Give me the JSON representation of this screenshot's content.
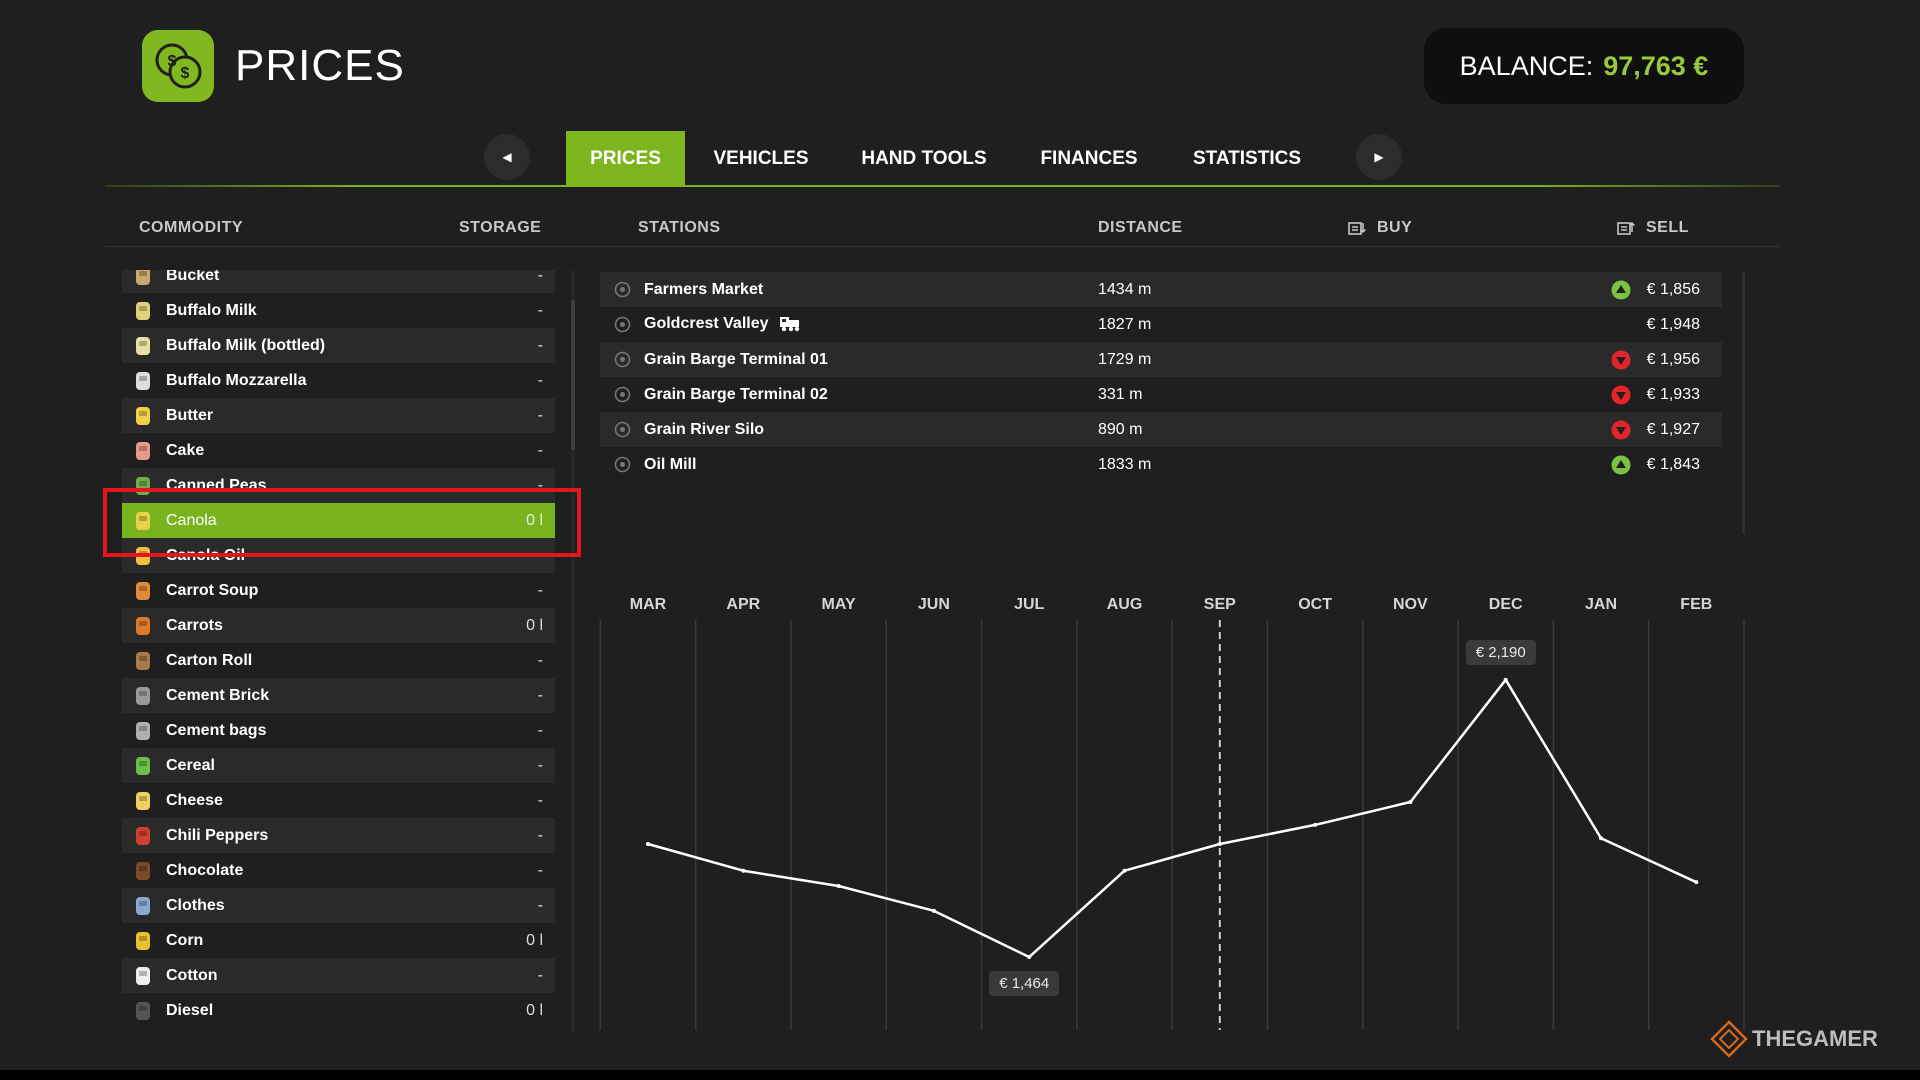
{
  "header": {
    "title": "PRICES",
    "balance_label": "BALANCE:",
    "balance_value": "97,763 €"
  },
  "tabs": [
    {
      "label": "PRICES",
      "active": true
    },
    {
      "label": "VEHICLES",
      "active": false
    },
    {
      "label": "HAND TOOLS",
      "active": false
    },
    {
      "label": "FINANCES",
      "active": false
    },
    {
      "label": "STATISTICS",
      "active": false
    }
  ],
  "columns": {
    "commodity": "COMMODITY",
    "storage": "STORAGE",
    "stations": "STATIONS",
    "distance": "DISTANCE",
    "buy": "BUY",
    "sell": "SELL"
  },
  "commodities": [
    {
      "name": "Bucket",
      "storage": "-"
    },
    {
      "name": "Buffalo Milk",
      "storage": "-"
    },
    {
      "name": "Buffalo Milk (bottled)",
      "storage": "-"
    },
    {
      "name": "Buffalo Mozzarella",
      "storage": "-"
    },
    {
      "name": "Butter",
      "storage": "-"
    },
    {
      "name": "Cake",
      "storage": "-"
    },
    {
      "name": "Canned Peas",
      "storage": "-"
    },
    {
      "name": "Canola",
      "storage": "0 l",
      "selected": true
    },
    {
      "name": "Canola Oil",
      "storage": "-"
    },
    {
      "name": "Carrot Soup",
      "storage": "-"
    },
    {
      "name": "Carrots",
      "storage": "0 l"
    },
    {
      "name": "Carton Roll",
      "storage": "-"
    },
    {
      "name": "Cement Brick",
      "storage": "-"
    },
    {
      "name": "Cement bags",
      "storage": "-"
    },
    {
      "name": "Cereal",
      "storage": "-"
    },
    {
      "name": "Cheese",
      "storage": "-"
    },
    {
      "name": "Chili Peppers",
      "storage": "-"
    },
    {
      "name": "Chocolate",
      "storage": "-"
    },
    {
      "name": "Clothes",
      "storage": "-"
    },
    {
      "name": "Corn",
      "storage": "0 l"
    },
    {
      "name": "Cotton",
      "storage": "-"
    },
    {
      "name": "Diesel",
      "storage": "0 l"
    }
  ],
  "stations": [
    {
      "name": "Farmers Market",
      "distance": "1434 m",
      "sell": "€ 1,856",
      "trend": "up",
      "train": false
    },
    {
      "name": "Goldcrest Valley",
      "distance": "1827 m",
      "sell": "€ 1,948",
      "trend": "none",
      "train": true
    },
    {
      "name": "Grain Barge Terminal 01",
      "distance": "1729 m",
      "sell": "€ 1,956",
      "trend": "down",
      "train": false
    },
    {
      "name": "Grain Barge Terminal 02",
      "distance": "331 m",
      "sell": "€ 1,933",
      "trend": "down",
      "train": false
    },
    {
      "name": "Grain River Silo",
      "distance": "890 m",
      "sell": "€ 1,927",
      "trend": "down",
      "train": false
    },
    {
      "name": "Oil Mill",
      "distance": "1833 m",
      "sell": "€ 1,843",
      "trend": "up",
      "train": false
    }
  ],
  "colors": {
    "accent": "#7db51e",
    "balance": "#97c93d",
    "trend_up": "#7cc242",
    "trend_down": "#e5232b",
    "highlight": "#e3151d"
  },
  "chart_data": {
    "type": "line",
    "categories": [
      "MAR",
      "APR",
      "MAY",
      "JUN",
      "JUL",
      "AUG",
      "SEP",
      "OCT",
      "NOV",
      "DEC",
      "JAN",
      "FEB"
    ],
    "values": [
      1760,
      1690,
      1650,
      1585,
      1464,
      1690,
      1760,
      1810,
      1870,
      2190,
      1775,
      1660
    ],
    "unit": "€",
    "current_month": "SEP",
    "annotations": [
      {
        "month": "JUL",
        "label": "€ 1,464",
        "kind": "min"
      },
      {
        "month": "DEC",
        "label": "€ 2,190",
        "kind": "max"
      }
    ],
    "ylim": [
      1430,
      2200
    ],
    "grid": true
  },
  "watermark": "THEGAMER"
}
